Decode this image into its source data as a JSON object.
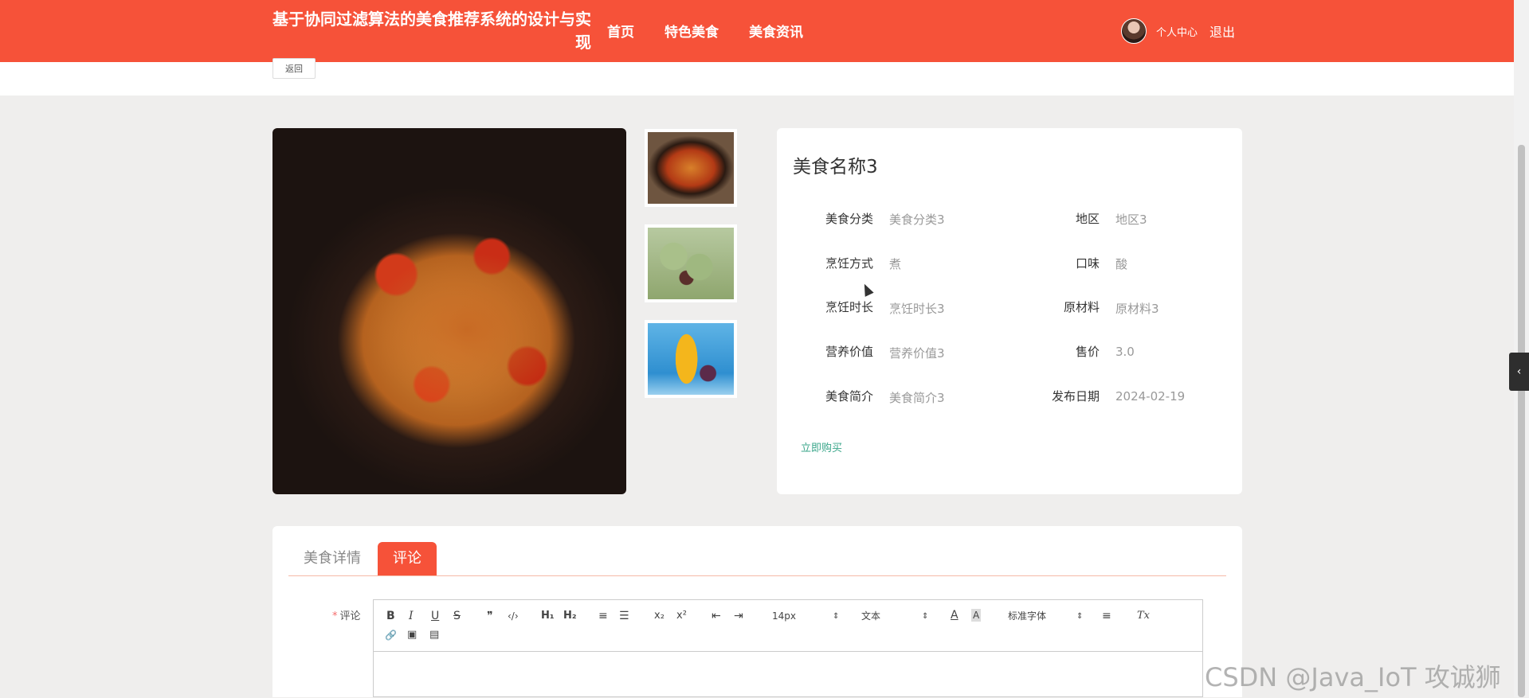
{
  "header": {
    "site_title": "基于协同过滤算法的美食推荐系统的设计与实现",
    "nav": [
      "首页",
      "特色美食",
      "美食资讯"
    ],
    "user_center": "个人中心",
    "logout": "退出"
  },
  "subbar": {
    "back_label": "返回"
  },
  "food": {
    "name": "美食名称3",
    "fields": {
      "category": {
        "label": "美食分类",
        "value": "美食分类3"
      },
      "region": {
        "label": "地区",
        "value": "地区3"
      },
      "method": {
        "label": "烹饪方式",
        "value": "煮"
      },
      "taste": {
        "label": "口味",
        "value": "酸"
      },
      "duration": {
        "label": "烹饪时长",
        "value": "烹饪时长3"
      },
      "material": {
        "label": "原材料",
        "value": "原材料3"
      },
      "nutrition": {
        "label": "营养价值",
        "value": "营养价值3"
      },
      "price": {
        "label": "售价",
        "value": "3.0"
      },
      "intro": {
        "label": "美食简介",
        "value": "美食简介3"
      },
      "date": {
        "label": "发布日期",
        "value": "2024-02-19"
      }
    },
    "buy_label": "立即购买"
  },
  "tabs": {
    "detail": "美食详情",
    "comment": "评论"
  },
  "comment": {
    "required_mark": "*",
    "label": "评论",
    "toolbar": {
      "bold": "B",
      "italic": "I",
      "underline": "U",
      "strike": "S",
      "quote": "❞",
      "code": "‹/›",
      "h1": "H₁",
      "h2": "H₂",
      "ordered_list": "≡",
      "bullet_list": "☰",
      "subscript": "x₂",
      "superscript": "x²",
      "outdent": "⇤",
      "indent": "⇥",
      "size": "14px",
      "header_select": "文本",
      "font_color": "A",
      "bg_color": "A",
      "font_select": "标准字体",
      "align": "≡",
      "clean": "Tx",
      "link": "🔗",
      "image": "▣",
      "video": "▤"
    }
  },
  "watermark": "CSDN @Java_IoT 攻诚狮"
}
